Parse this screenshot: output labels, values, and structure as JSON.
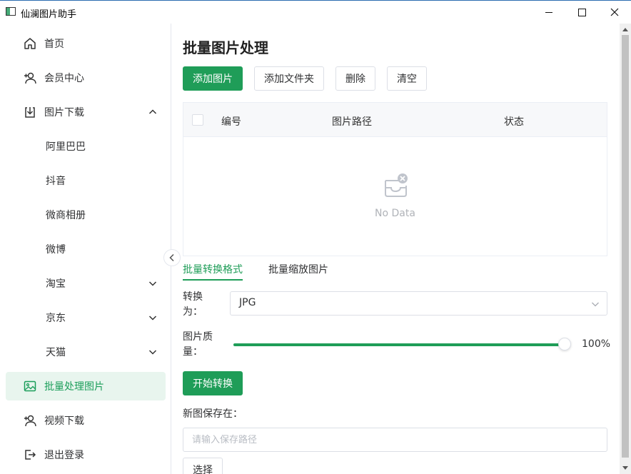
{
  "window": {
    "title": "仙澜图片助手"
  },
  "sidebar": {
    "items": [
      {
        "label": "首页",
        "icon": "home-icon"
      },
      {
        "label": "会员中心",
        "icon": "user-add-icon"
      },
      {
        "label": "图片下载",
        "icon": "download-icon",
        "expanded": true
      },
      {
        "label": "阿里巴巴"
      },
      {
        "label": "抖音"
      },
      {
        "label": "微商相册"
      },
      {
        "label": "微博"
      },
      {
        "label": "淘宝",
        "expandable": true
      },
      {
        "label": "京东",
        "expandable": true
      },
      {
        "label": "天猫",
        "expandable": true
      },
      {
        "label": "批量处理图片",
        "icon": "picture-icon",
        "active": true
      },
      {
        "label": "视频下载",
        "icon": "user-add-icon"
      },
      {
        "label": "退出登录",
        "icon": "logout-icon"
      }
    ]
  },
  "main": {
    "title": "批量图片处理",
    "toolbar": {
      "add_image": "添加图片",
      "add_folder": "添加文件夹",
      "delete": "删除",
      "clear": "清空"
    },
    "table": {
      "columns": [
        "编号",
        "图片路径",
        "状态"
      ],
      "empty_text": "No Data"
    },
    "tabs": [
      "批量转换格式",
      "批量缩放图片"
    ],
    "form": {
      "convert_label": "转换\n为：",
      "convert_label_line1": "转换",
      "convert_label_line2": "为：",
      "format_value": "JPG",
      "quality_label_line1": "图片质",
      "quality_label_line2": "量：",
      "quality_value": 100,
      "quality_text": "100%",
      "start_button": "开始转换",
      "save_label": "新图保存在：",
      "save_placeholder": "请输入保存路径",
      "choose_button": "选择"
    }
  },
  "colors": {
    "accent": "#1f9d58",
    "active_bg": "#e8f5ee"
  }
}
